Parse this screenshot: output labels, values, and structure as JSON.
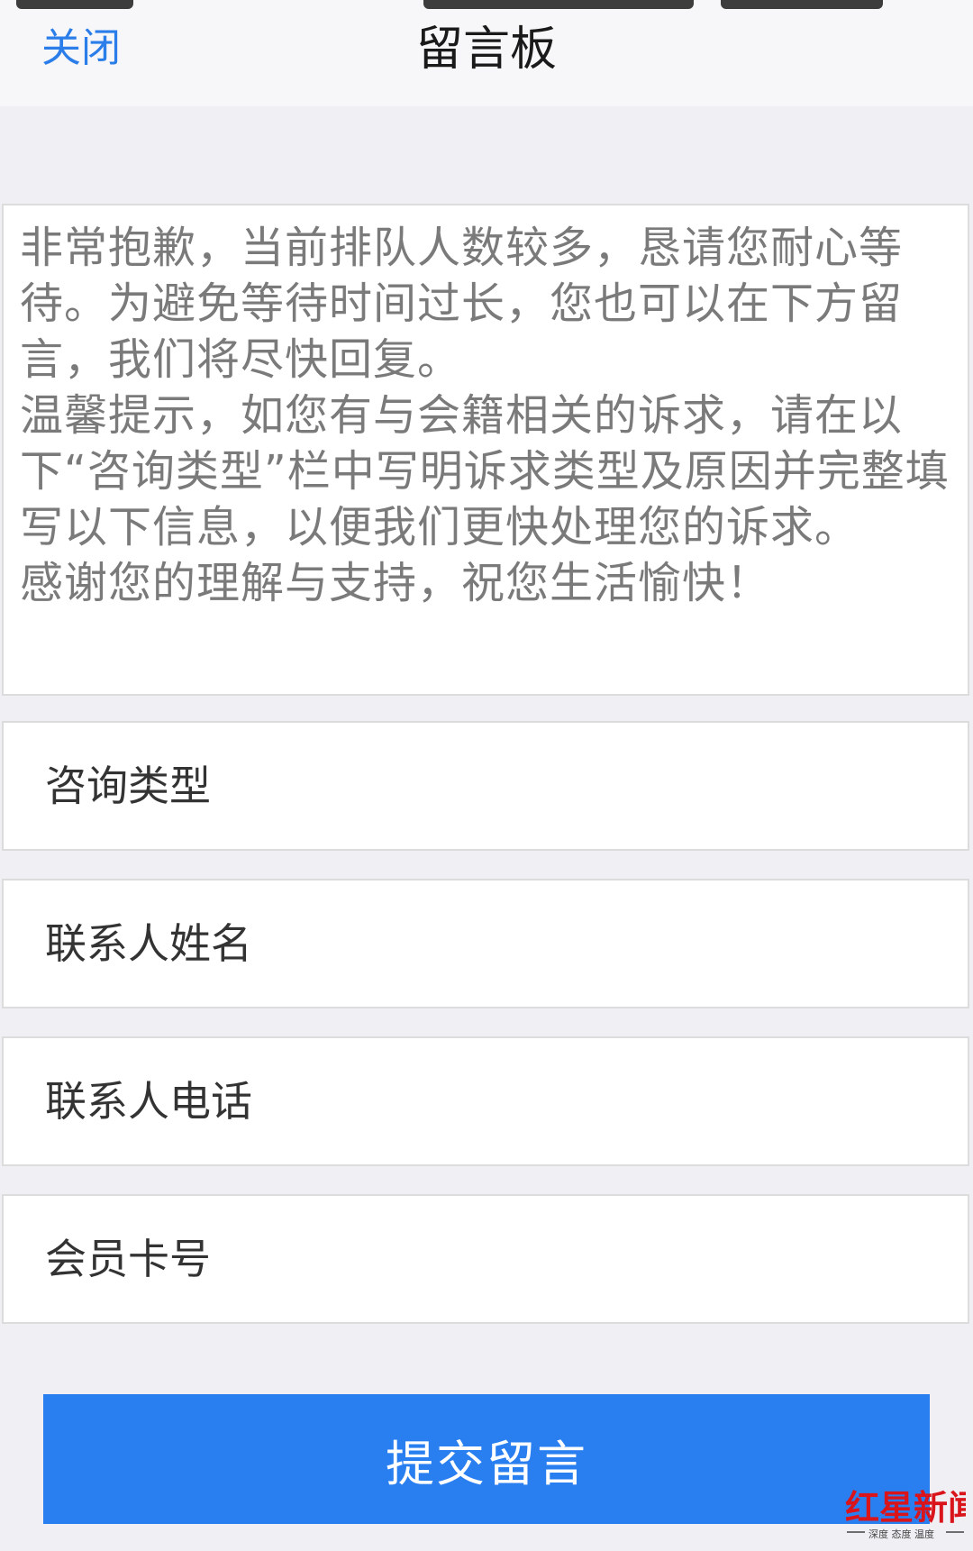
{
  "navbar": {
    "close_label": "关闭",
    "title": "留言板"
  },
  "notice": {
    "paragraphs": [
      "非常抱歉，当前排队人数较多，恳请您耐心等待。为避免等待时间过长，您也可以在下方留言，我们将尽快回复。",
      "温馨提示，如您有与会籍相关的诉求，请在以下“咨询类型”栏中写明诉求类型及原因并完整填写以下信息，以便我们更快处理您的诉求。",
      "感谢您的理解与支持，祝您生活愉快！"
    ]
  },
  "form": {
    "fields": [
      {
        "label": "咨询类型"
      },
      {
        "label": "联系人姓名"
      },
      {
        "label": "联系人电话"
      },
      {
        "label": "会员卡号"
      }
    ],
    "submit_label": "提交留言"
  },
  "watermark": {
    "brand": "红星新闻",
    "slogan": "深度 态度 温度",
    "color": "#d9141b"
  },
  "colors": {
    "accent": "#2a7ff0",
    "link": "#2b7de9",
    "background": "#efeff4"
  }
}
